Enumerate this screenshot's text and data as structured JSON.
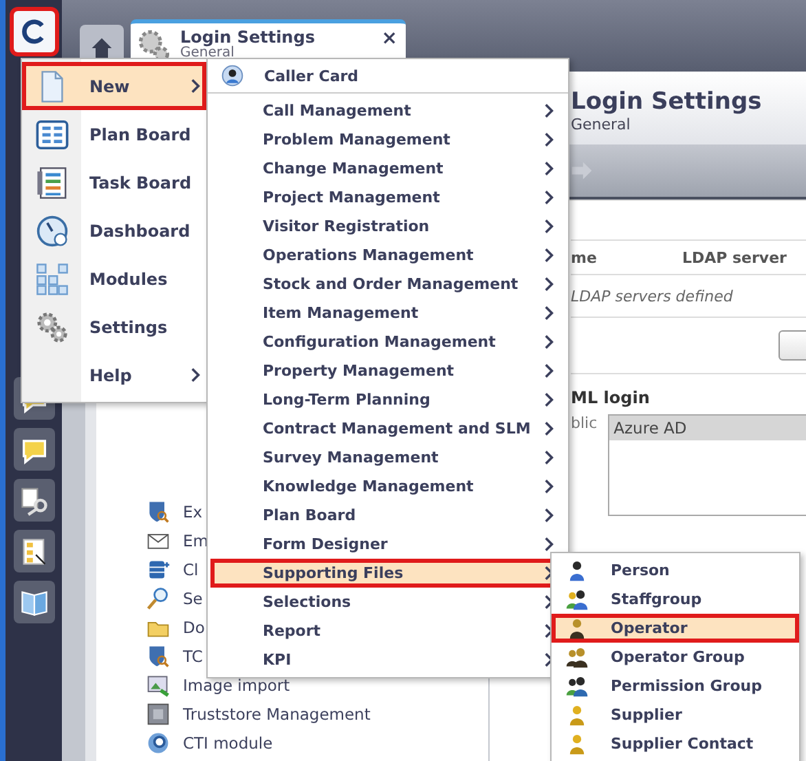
{
  "sidebar": {
    "logo_button": {
      "highlighted": true
    }
  },
  "tabs": [
    {
      "kind": "home",
      "selected": false
    },
    {
      "kind": "document",
      "title": "Login Settings",
      "subtitle": "General",
      "close": "×",
      "selected": true
    }
  ],
  "modules_list": [
    "Ex",
    "Em",
    "Cl",
    "Se",
    "Do",
    "TC",
    "Image import",
    "Truststore Management",
    "CTI module"
  ],
  "panel": {
    "title": "Login Settings",
    "subtitle": "General",
    "ldap_table": {
      "columns": [
        "me",
        "LDAP server"
      ],
      "empty_text": "LDAP servers defined"
    },
    "saml": {
      "title": "ML login",
      "label": "blic",
      "list": [
        {
          "text": "Azure AD",
          "selected": true
        }
      ]
    }
  },
  "main_menu": [
    {
      "label": "New",
      "submenu": true,
      "selected": true
    },
    {
      "label": "Plan Board",
      "submenu": false,
      "selected": false
    },
    {
      "label": "Task Board",
      "submenu": false,
      "selected": false
    },
    {
      "label": "Dashboard",
      "submenu": false,
      "selected": false
    },
    {
      "label": "Modules",
      "submenu": false,
      "selected": false
    },
    {
      "label": "Settings",
      "submenu": false,
      "selected": false
    },
    {
      "label": "Help",
      "submenu": true,
      "selected": false
    }
  ],
  "new_menu": [
    {
      "kind": "card",
      "label": "Caller Card",
      "submenu": false,
      "selected": false
    },
    {
      "kind": "item",
      "label": "Call Management",
      "submenu": true,
      "selected": false
    },
    {
      "kind": "item",
      "label": "Problem Management",
      "submenu": true,
      "selected": false
    },
    {
      "kind": "item",
      "label": "Change Management",
      "submenu": true,
      "selected": false
    },
    {
      "kind": "item",
      "label": "Project Management",
      "submenu": true,
      "selected": false
    },
    {
      "kind": "item",
      "label": "Visitor Registration",
      "submenu": true,
      "selected": false
    },
    {
      "kind": "item",
      "label": "Operations Management",
      "submenu": true,
      "selected": false
    },
    {
      "kind": "item",
      "label": "Stock and Order Management",
      "submenu": true,
      "selected": false
    },
    {
      "kind": "item",
      "label": "Item Management",
      "submenu": true,
      "selected": false
    },
    {
      "kind": "item",
      "label": "Configuration Management",
      "submenu": true,
      "selected": false
    },
    {
      "kind": "item",
      "label": "Property Management",
      "submenu": true,
      "selected": false
    },
    {
      "kind": "item",
      "label": "Long-Term Planning",
      "submenu": true,
      "selected": false
    },
    {
      "kind": "item",
      "label": "Contract Management and SLM",
      "submenu": true,
      "selected": false
    },
    {
      "kind": "item",
      "label": "Survey Management",
      "submenu": true,
      "selected": false
    },
    {
      "kind": "item",
      "label": "Knowledge Management",
      "submenu": true,
      "selected": false
    },
    {
      "kind": "item",
      "label": "Plan Board",
      "submenu": true,
      "selected": false
    },
    {
      "kind": "item",
      "label": "Form Designer",
      "submenu": true,
      "selected": false
    },
    {
      "kind": "item",
      "label": "Supporting Files",
      "submenu": true,
      "selected": true
    },
    {
      "kind": "item",
      "label": "Selections",
      "submenu": true,
      "selected": false
    },
    {
      "kind": "item",
      "label": "Report",
      "submenu": true,
      "selected": false
    },
    {
      "kind": "item",
      "label": "KPI",
      "submenu": true,
      "selected": false
    }
  ],
  "supporting_files_menu": [
    {
      "label": "Person",
      "selected": false
    },
    {
      "label": "Staffgroup",
      "selected": false
    },
    {
      "label": "Operator",
      "selected": true
    },
    {
      "label": "Operator Group",
      "selected": false
    },
    {
      "label": "Permission Group",
      "selected": false
    },
    {
      "label": "Supplier",
      "selected": false
    },
    {
      "label": "Supplier Contact",
      "selected": false
    }
  ]
}
